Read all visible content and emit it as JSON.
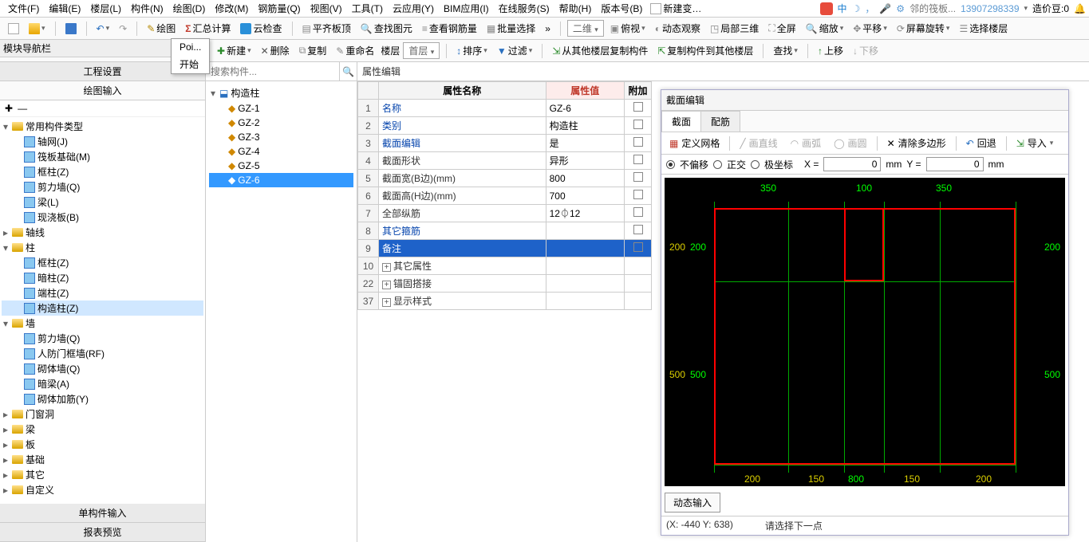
{
  "menu": {
    "items": [
      "文件(F)",
      "编辑(E)",
      "楼层(L)",
      "构件(N)",
      "绘图(D)",
      "修改(M)",
      "钢筋量(Q)",
      "视图(V)",
      "工具(T)",
      "云应用(Y)",
      "BIM应用(I)",
      "在线服务(S)",
      "帮助(H)",
      "版本号(B)"
    ],
    "newdoc": "新建变…"
  },
  "topright": {
    "title_fragment": "邻的筏板...",
    "phone": "13907298339",
    "beans": "造价豆:0"
  },
  "toolbar1": {
    "draw": "绘图",
    "sumcalc": "汇总计算",
    "cloud": "云检查",
    "level": "平齐板顶",
    "find": "查找图元",
    "viewrebar": "查看钢筋量",
    "batch": "批量选择",
    "twod": "二维",
    "lookdown": "俯视",
    "dynview": "动态观察",
    "local3d": "局部三维",
    "fullscreen": "全屏",
    "zoom": "缩放",
    "pan": "平移",
    "rotate": "屏幕旋转",
    "selfloor": "选择楼层"
  },
  "navLabel": "模块导航栏",
  "leftPanels": {
    "settings": "工程设置",
    "drawin": "绘图输入",
    "single": "单构件输入",
    "report": "报表预览"
  },
  "tree": {
    "root": "常用构件类型",
    "items": [
      "轴网(J)",
      "筏板基础(M)",
      "框柱(Z)",
      "剪力墙(Q)",
      "梁(L)",
      "现浇板(B)"
    ],
    "axis": "轴线",
    "col": "柱",
    "cols": [
      "框柱(Z)",
      "暗柱(Z)",
      "端柱(Z)",
      "构造柱(Z)"
    ],
    "wall": "墙",
    "walls": [
      "剪力墙(Q)",
      "人防门框墙(RF)",
      "砌体墙(Q)",
      "暗梁(A)",
      "砌体加筋(Y)"
    ],
    "others": [
      "门窗洞",
      "梁",
      "板",
      "基础",
      "其它",
      "自定义"
    ]
  },
  "midbar": {
    "new": "新建",
    "del": "删除",
    "copy": "复制",
    "rename": "重命名",
    "floor": "楼层",
    "first": "首层",
    "sort": "排序",
    "filter": "过滤",
    "copyfrom": "从其他楼层复制构件",
    "copyto": "复制构件到其他楼层",
    "search": "查找",
    "up": "上移",
    "down": "下移"
  },
  "searchPlaceholder": "搜索构件...",
  "midtree": {
    "root": "构造柱",
    "items": [
      "GZ-1",
      "GZ-2",
      "GZ-3",
      "GZ-4",
      "GZ-5",
      "GZ-6"
    ]
  },
  "prop": {
    "title": "属性编辑",
    "colname": "属性名称",
    "colval": "属性值",
    "coladd": "附加",
    "rows": [
      {
        "n": "1",
        "name": "名称",
        "val": "GZ-6",
        "blue": true,
        "chk": false
      },
      {
        "n": "2",
        "name": "类别",
        "val": "构造柱",
        "blue": true,
        "chk": true
      },
      {
        "n": "3",
        "name": "截面编辑",
        "val": "是",
        "blue": true,
        "chk": false
      },
      {
        "n": "4",
        "name": "截面形状",
        "val": "异形",
        "blue": false,
        "chk": true
      },
      {
        "n": "5",
        "name": "截面宽(B边)(mm)",
        "val": "800",
        "blue": false,
        "chk": true
      },
      {
        "n": "6",
        "name": "截面高(H边)(mm)",
        "val": "700",
        "blue": false,
        "chk": true
      },
      {
        "n": "7",
        "name": "全部纵筋",
        "val": "12⏀12",
        "blue": false,
        "chk": true
      },
      {
        "n": "8",
        "name": "其它箍筋",
        "val": "",
        "blue": true,
        "chk": true
      },
      {
        "n": "9",
        "name": "备注",
        "val": "",
        "blue": true,
        "chk": true,
        "sel": true
      },
      {
        "n": "10",
        "name": "其它属性",
        "val": "",
        "plus": true
      },
      {
        "n": "22",
        "name": "锚固搭接",
        "val": "",
        "plus": true
      },
      {
        "n": "37",
        "name": "显示样式",
        "val": "",
        "plus": true
      }
    ]
  },
  "section": {
    "title": "截面编辑",
    "tab1": "截面",
    "tab2": "配筋",
    "definegrid": "定义网格",
    "drawline": "画直线",
    "drawarc": "画弧",
    "drawcircle": "画圆",
    "clearpoly": "清除多边形",
    "undo": "回退",
    "import": "导入",
    "opt1": "不偏移",
    "opt2": "正交",
    "opt3": "极坐标",
    "xlbl": "X =",
    "ylbl": "Y =",
    "mm": "mm",
    "xval": "0",
    "yval": "0",
    "topdims": [
      "350",
      "100",
      "350"
    ],
    "leftdims": [
      "200",
      "500"
    ],
    "rightdims": [
      "200",
      "500"
    ],
    "leftdims2": [
      "200",
      "500"
    ],
    "bottom": "800",
    "bottomdims": [
      "200",
      "150",
      "150",
      "200"
    ],
    "dyn": "动态输入",
    "status_xy": "(X: -440 Y: 638)",
    "status_hint": "请选择下一点"
  },
  "dropdown": {
    "poi": "Poi...",
    "start": "开始"
  }
}
